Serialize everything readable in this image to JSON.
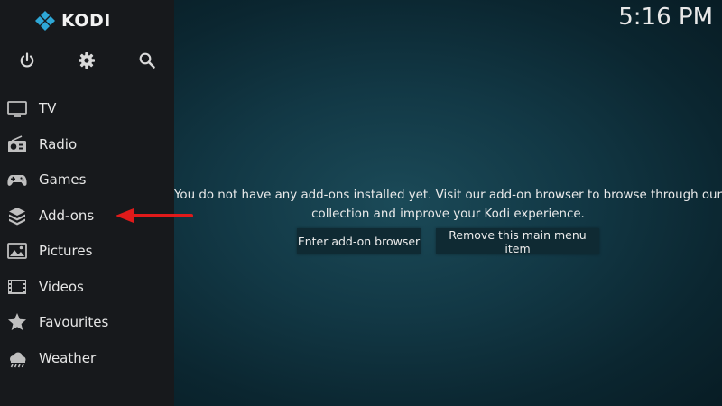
{
  "app": {
    "name": "KODI"
  },
  "clock": {
    "time": "5:16 PM"
  },
  "top_icons": [
    {
      "icon": "power-icon"
    },
    {
      "icon": "gear-icon"
    },
    {
      "icon": "search-icon"
    }
  ],
  "sidebar": {
    "items": [
      {
        "label": "TV",
        "icon": "tv-icon"
      },
      {
        "label": "Radio",
        "icon": "radio-icon"
      },
      {
        "label": "Games",
        "icon": "gamepad-icon"
      },
      {
        "label": "Add-ons",
        "icon": "box-icon"
      },
      {
        "label": "Pictures",
        "icon": "picture-icon"
      },
      {
        "label": "Videos",
        "icon": "film-icon"
      },
      {
        "label": "Favourites",
        "icon": "star-icon"
      },
      {
        "label": "Weather",
        "icon": "weather-icon"
      }
    ]
  },
  "main": {
    "message_line1": "You do not have any add-ons installed yet. Visit our add-on browser to browse through our",
    "message_line2": "collection and improve your Kodi experience.",
    "primary_button": "Enter add-on browser",
    "secondary_button": "Remove this main menu item"
  },
  "colors": {
    "sidebar_bg": "#17191c",
    "kodi_blue": "#2ea7d6",
    "annotation_arrow": "#e01a1a"
  }
}
